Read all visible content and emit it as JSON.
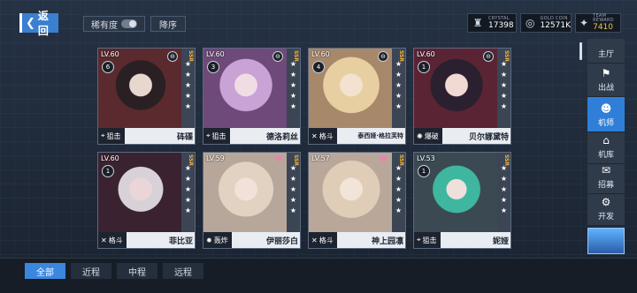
{
  "header": {
    "back_label": "返回",
    "rarity_filter_label": "稀有度",
    "sort_label": "降序"
  },
  "resources": [
    {
      "label": "CRYSTAL",
      "value": "17398",
      "icon": "crystal-icon"
    },
    {
      "label": "GOLD COIN",
      "value": "12571K",
      "icon": "gold-coin-icon"
    },
    {
      "label": "TEAM REWARD",
      "value": "7410",
      "icon": "team-reward-icon"
    }
  ],
  "cards": [
    {
      "level": "LV.60",
      "rarity": "SSR",
      "badge": "6",
      "class": "狙击",
      "class_icon": "sniper-icon",
      "name": "砗磲",
      "stars": 5,
      "color": "#5b2a2e"
    },
    {
      "level": "LV.60",
      "rarity": "SSR",
      "badge": "3",
      "class": "狙击",
      "class_icon": "sniper-icon",
      "name": "德洛莉丝",
      "stars": 5,
      "color": "#6e4a7a"
    },
    {
      "level": "LV.60",
      "rarity": "SSR",
      "badge": "4",
      "class": "格斗",
      "class_icon": "melee-icon",
      "name": "泰西娅·格拉芙特",
      "stars": 5,
      "color": "#a8886a"
    },
    {
      "level": "LV.60",
      "rarity": "SSR",
      "badge": "1",
      "class": "爆破",
      "class_icon": "blast-icon",
      "name": "贝尔娜黛特",
      "stars": 5,
      "color": "#5a2435"
    },
    {
      "level": "LV.60",
      "rarity": "SSR",
      "badge": "1",
      "class": "格斗",
      "class_icon": "melee-icon",
      "name": "菲比亚",
      "stars": 5,
      "color": "#3a2230"
    },
    {
      "level": "LV.59",
      "rarity": "SSR",
      "badge": "1",
      "class": "轰炸",
      "class_icon": "bomb-icon",
      "name": "伊丽莎白",
      "stars": 5,
      "color": "#b7a79a"
    },
    {
      "level": "LV.57",
      "rarity": "SSR",
      "badge": "1",
      "class": "格斗",
      "class_icon": "melee-icon",
      "name": "神上园凛",
      "stars": 5,
      "color": "#b9a89a"
    },
    {
      "level": "LV.53",
      "rarity": "SSR",
      "badge": "1",
      "class": "狙击",
      "class_icon": "sniper-icon",
      "name": "妮娅",
      "stars": 5,
      "color": "#3b4a52"
    }
  ],
  "sidebar": {
    "items": [
      {
        "label": "主厅",
        "icon": "home-icon"
      },
      {
        "label": "出战",
        "icon": "battle-icon"
      },
      {
        "label": "机师",
        "icon": "pilot-icon"
      },
      {
        "label": "机库",
        "icon": "hangar-icon"
      },
      {
        "label": "招募",
        "icon": "recruit-icon"
      },
      {
        "label": "开发",
        "icon": "develop-icon"
      }
    ],
    "active_index": 2
  },
  "tabs": {
    "items": [
      "全部",
      "近程",
      "中程",
      "远程"
    ],
    "active_index": 0
  },
  "colors": {
    "accent": "#3b87e0",
    "rarity": "#f2b23c",
    "team_reward": "#f5c242"
  }
}
